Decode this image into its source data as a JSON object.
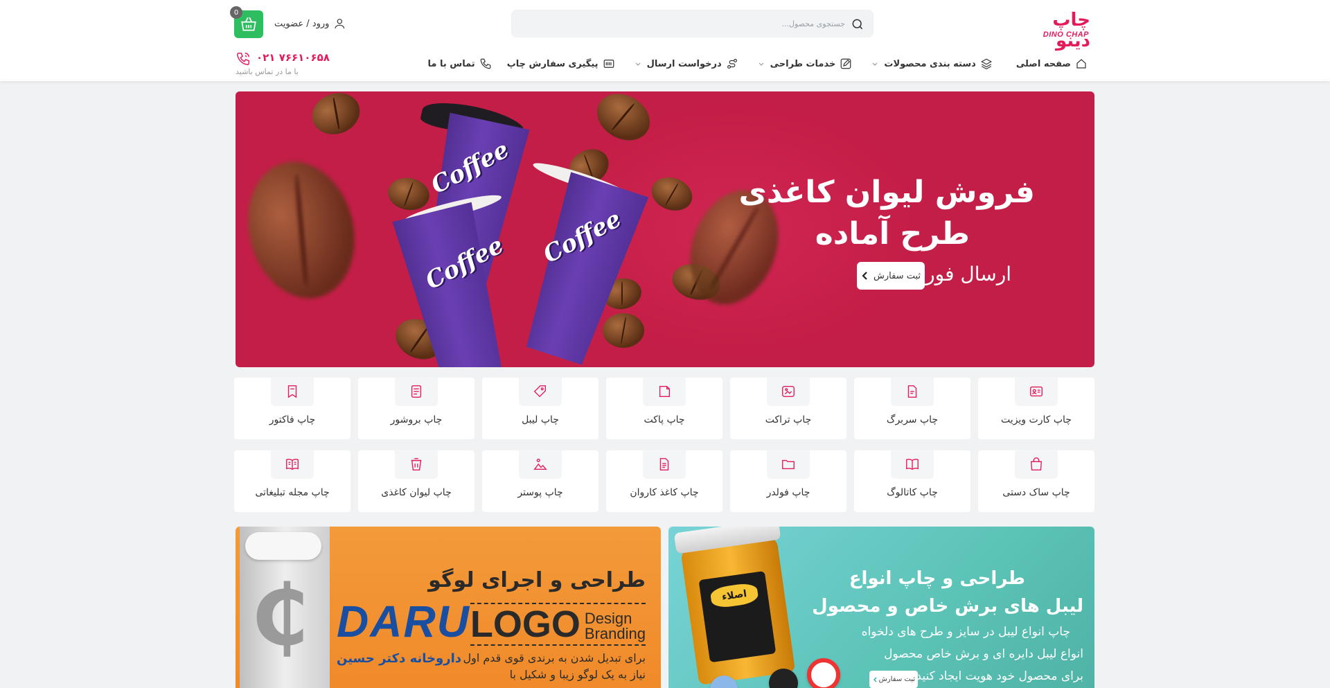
{
  "header": {
    "logo_text_fa": "چاپ دینو",
    "logo_text_en": "DINO CHAP",
    "search_placeholder": "جستجوی محصول...",
    "login_label": "ورود / عضویت",
    "cart_count": "0",
    "phone_number": "۰۲۱ ۷۶۶۱۰۶۵۸",
    "phone_subtitle": "با ما در تماس باشید"
  },
  "nav": {
    "items": [
      {
        "label": "صفحه اصلی",
        "icon": "home-icon",
        "has_dropdown": false
      },
      {
        "label": "دسته بندی محصولات",
        "icon": "layers-icon",
        "has_dropdown": true
      },
      {
        "label": "خدمات طراحی",
        "icon": "edit-icon",
        "has_dropdown": true
      },
      {
        "label": "درخواست ارسال",
        "icon": "route-icon",
        "has_dropdown": true
      },
      {
        "label": "پیگیری سفارش چاپ",
        "icon": "barcode-icon",
        "has_dropdown": false
      },
      {
        "label": "تماس با ما",
        "icon": "phone-icon",
        "has_dropdown": false
      }
    ]
  },
  "hero": {
    "line1": "فروش لیوان کاغذی",
    "line2": "طرح آماده",
    "line3": "ارسال فوری",
    "button_label": "ثبت سفارش",
    "cup_text": "Coffee"
  },
  "categories": [
    {
      "label": "چاپ کارت ویزیت",
      "icon": "id-card-icon"
    },
    {
      "label": "چاپ سربرگ",
      "icon": "letterhead-icon"
    },
    {
      "label": "چاپ تراکت",
      "icon": "flyer-icon"
    },
    {
      "label": "چاپ پاکت",
      "icon": "envelope-icon"
    },
    {
      "label": "چاپ لیبل",
      "icon": "tag-icon"
    },
    {
      "label": "چاپ بروشور",
      "icon": "brochure-icon"
    },
    {
      "label": "چاپ فاکتور",
      "icon": "receipt-icon"
    },
    {
      "label": "چاپ ساک دستی",
      "icon": "bag-icon"
    },
    {
      "label": "چاپ کاتالوگ",
      "icon": "book-icon"
    },
    {
      "label": "چاپ فولدر",
      "icon": "folder-icon"
    },
    {
      "label": "چاپ کاغذ کاروان",
      "icon": "document-icon"
    },
    {
      "label": "چاپ پوستر",
      "icon": "poster-icon"
    },
    {
      "label": "چاپ لیوان کاغذی",
      "icon": "cup-icon"
    },
    {
      "label": "چاپ مجله تبلیغاتی",
      "icon": "magazine-icon"
    }
  ],
  "banner_logo": {
    "title": "طراحی و اجرای لوگو",
    "logo_big": "LOGO",
    "logo_small1": "Design",
    "logo_small2": "Branding",
    "desc1": "برای تبدیل شدن به برندی قوی قدم اول",
    "desc2": "نیاز به یک لوگو زیبا و شکیل با",
    "sample_brand": "DARU",
    "sample_brand_sub": "داروخانه دکتر حسین"
  },
  "banner_label": {
    "title1": "طراحی و چاپ انواع",
    "title2": "لیبل های برش خاص و محصول",
    "desc1": "چاپ انواع لیبل در سایز و طرح های دلخواه",
    "desc2": "انواع لیبل دایره ای و برش خاص محصول",
    "desc3": "برای محصول خود هویت ایجاد کنید",
    "button_label": "ثبت سفارش",
    "jar_label": "اصلاء"
  },
  "colors": {
    "brand": "#e41b5b",
    "cart": "#2ebd5f",
    "hero_bg": "#c31e47"
  }
}
